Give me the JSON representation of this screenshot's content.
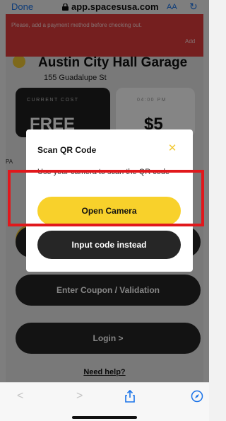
{
  "browser": {
    "done_label": "Done",
    "url": "app.spacesusa.com",
    "text_size_label": "AA",
    "reload_icon": "reload-icon"
  },
  "alert": {
    "message": "Please, add a payment method before checking out.",
    "action_label": "Add"
  },
  "garage": {
    "title": "Austin City Hall Garage",
    "address": "155 Guadalupe St"
  },
  "pricing": {
    "current_label": "CURRENT COST",
    "current_value": "FREE",
    "time_label": "04:00 PM",
    "time_value": "$5"
  },
  "payment_label": "PA",
  "actions": {
    "hidden_action": "",
    "coupon": "Enter Coupon / Validation",
    "login": "Login >"
  },
  "help_label": "Need help?",
  "modal": {
    "title": "Scan QR Code",
    "description": "Use your camera to scan the QR code",
    "open_camera": "Open Camera",
    "input_code": "Input code instead"
  },
  "colors": {
    "accent_yellow": "#f8d12b",
    "alert_red": "#e03c3c",
    "highlight_red": "#e1181c",
    "link_blue": "#1a73e8"
  }
}
